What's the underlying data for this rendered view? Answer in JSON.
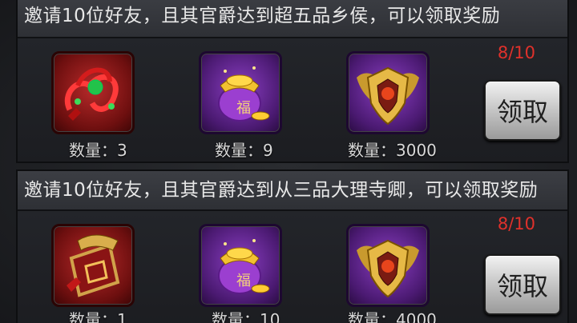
{
  "tasks": [
    {
      "title": "邀请10位好友，且其官爵达到超五品乡侯，可以领取奖励",
      "progress": "8/10",
      "claim_label": "领取",
      "rewards": [
        {
          "name": "red-knot-charm",
          "quantity_label": "数量：3"
        },
        {
          "name": "gold-treasure-bag",
          "quantity_label": "数量：9"
        },
        {
          "name": "golden-winged-shield",
          "quantity_label": "数量：3000"
        }
      ]
    },
    {
      "title": "邀请10位好友，且其官爵达到从三品大理寺卿，可以领取奖励",
      "progress": "8/10",
      "claim_label": "领取",
      "rewards": [
        {
          "name": "golden-scroll-token",
          "quantity_label": "数量：1"
        },
        {
          "name": "gold-treasure-bag",
          "quantity_label": "数量：10"
        },
        {
          "name": "golden-winged-shield",
          "quantity_label": "数量：4000"
        }
      ]
    }
  ],
  "colors": {
    "progress": "#e0312b",
    "title_text": "#e9e9e9",
    "qty_text": "#d8d8d8"
  }
}
